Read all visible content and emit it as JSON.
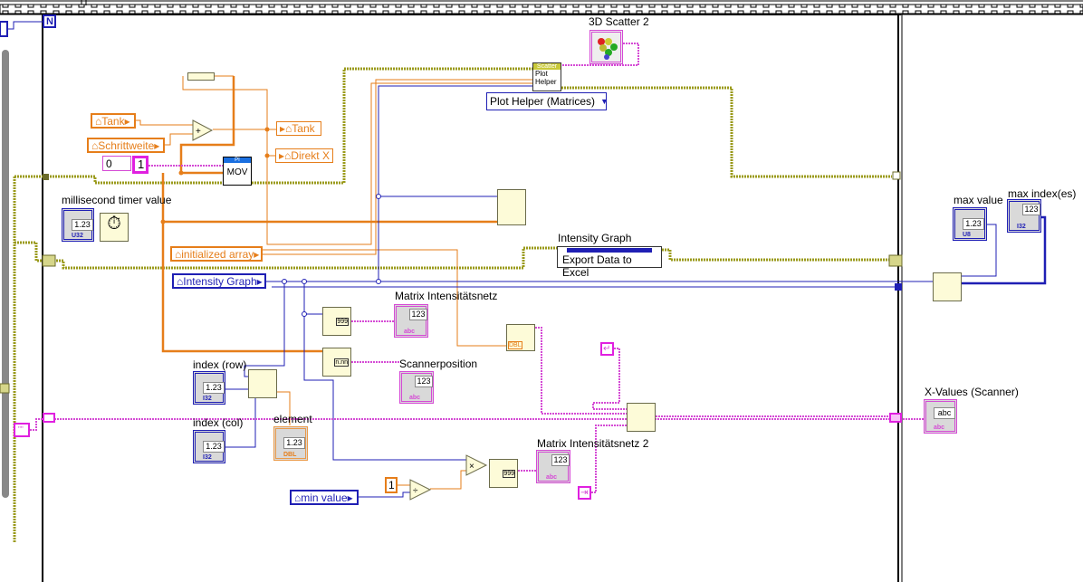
{
  "loop_terminal": "N",
  "scatter": {
    "label": "3D Scatter 2",
    "helper_title": "Scatter",
    "helper_text": "Plot Helper",
    "ring_value": "Plot Helper (Matrices)"
  },
  "locals": {
    "tank_in": "Tank",
    "schrittweite": "Schrittweite",
    "tank_out": "Tank",
    "direkt_x": "Direkt X",
    "initialized_array": "initialized array",
    "intensity_graph": "Intensity Graph",
    "min_value": "min value"
  },
  "constants": {
    "zero": "0",
    "one": "1",
    "one_b": "1"
  },
  "mov": {
    "title": "PI",
    "text": "MOV"
  },
  "timer": {
    "label": "millisecond timer value",
    "value": "1.23",
    "type": "U32"
  },
  "property_node": {
    "label": "Intensity Graph",
    "method": "Export Data to Excel"
  },
  "indicators": {
    "max_value": {
      "label": "max value",
      "type": "U8",
      "value": "1.23"
    },
    "max_index": {
      "label": "max index(es)",
      "type": "I32",
      "value": "123"
    },
    "matrix1": {
      "label": "Matrix Intensitätsnetz",
      "value": "123",
      "type": "abc"
    },
    "scannerposition": {
      "label": "Scannerposition",
      "value": "123",
      "type": "abc"
    },
    "index_row": {
      "label": "index (row)",
      "value": "1.23",
      "type": "I32"
    },
    "index_col": {
      "label": "index (col)",
      "value": "1.23",
      "type": "I32"
    },
    "element": {
      "label": "element",
      "value": "1.23",
      "type": "DBL"
    },
    "x_values": {
      "label": "X-Values (Scanner)",
      "value": "abc",
      "type": "abc"
    },
    "matrix2": {
      "label": "Matrix Intensitätsnetz 2",
      "value": "123",
      "type": "abc"
    }
  },
  "nodes": {
    "num_to_str": "999",
    "frac_to_str": "n.nn",
    "format_type": "DBL"
  },
  "colors": {
    "orange": "#e67e1a",
    "blue": "#1f1fb4",
    "pink": "#d54bd5",
    "error": "#9a9a1a"
  }
}
